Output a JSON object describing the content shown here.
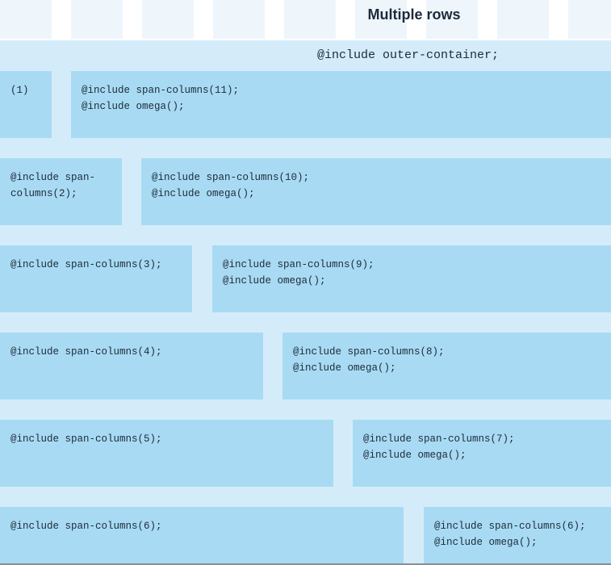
{
  "title": "Multiple rows",
  "outer_label": "@include outer-container;",
  "rows": [
    {
      "left": {
        "lines": [
          "(1)"
        ]
      },
      "right": {
        "lines": [
          "@include span-columns(11);",
          "@include omega();"
        ]
      }
    },
    {
      "left": {
        "lines": [
          "@include span-",
          "columns(2);"
        ]
      },
      "right": {
        "lines": [
          "@include span-columns(10);",
          "@include omega();"
        ]
      }
    },
    {
      "left": {
        "lines": [
          "@include span-columns(3);"
        ]
      },
      "right": {
        "lines": [
          "@include span-columns(9);",
          "@include omega();"
        ]
      }
    },
    {
      "left": {
        "lines": [
          "@include span-columns(4);"
        ]
      },
      "right": {
        "lines": [
          "@include span-columns(8);",
          "@include omega();"
        ]
      }
    },
    {
      "left": {
        "lines": [
          "@include span-columns(5);"
        ]
      },
      "right": {
        "lines": [
          "@include span-columns(7);",
          "@include omega();"
        ]
      }
    },
    {
      "left": {
        "lines": [
          "@include span-columns(6);"
        ]
      },
      "right": {
        "lines": [
          "@include span-columns(6);",
          "@include omega();"
        ]
      }
    }
  ]
}
